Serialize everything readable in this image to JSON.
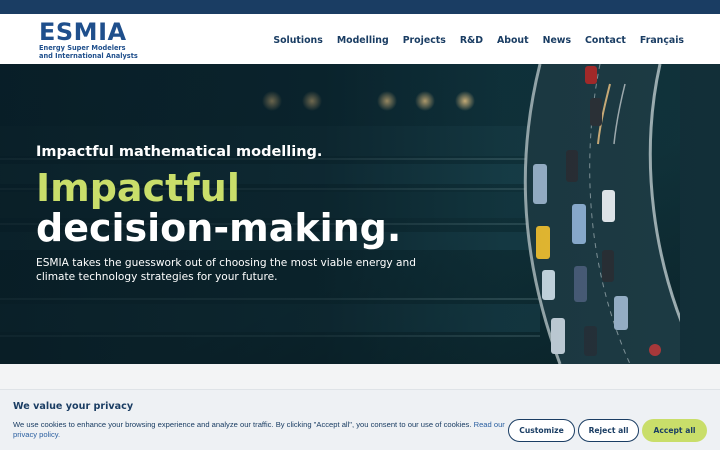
{
  "brand": {
    "name": "ESMIA",
    "subtitle_line1": "Energy Super Modelers",
    "subtitle_line2": "and International Analysts",
    "primary_color": "#1a3d63",
    "accent_color": "#c9de6a"
  },
  "nav": {
    "items": [
      {
        "label": "Solutions"
      },
      {
        "label": "Modelling"
      },
      {
        "label": "Projects"
      },
      {
        "label": "R&D"
      },
      {
        "label": "About"
      },
      {
        "label": "News"
      },
      {
        "label": "Contact"
      },
      {
        "label": "Français"
      }
    ]
  },
  "hero": {
    "kicker": "Impactful mathematical modelling.",
    "headline_accent": "Impactful",
    "headline_main": "decision-making.",
    "description": "ESMIA takes the guesswork out of choosing the most viable energy and climate technology strategies for your future.",
    "background_image": "aerial-highway-night-traffic"
  },
  "cookie_banner": {
    "title": "We value your privacy",
    "text": "We use cookies to enhance your browsing experience and analyze our traffic. By clicking \"Accept all\", you consent to our use of cookies.",
    "link_text": "Read our privacy policy.",
    "customize_label": "Customize",
    "reject_label": "Reject all",
    "accept_label": "Accept all"
  }
}
